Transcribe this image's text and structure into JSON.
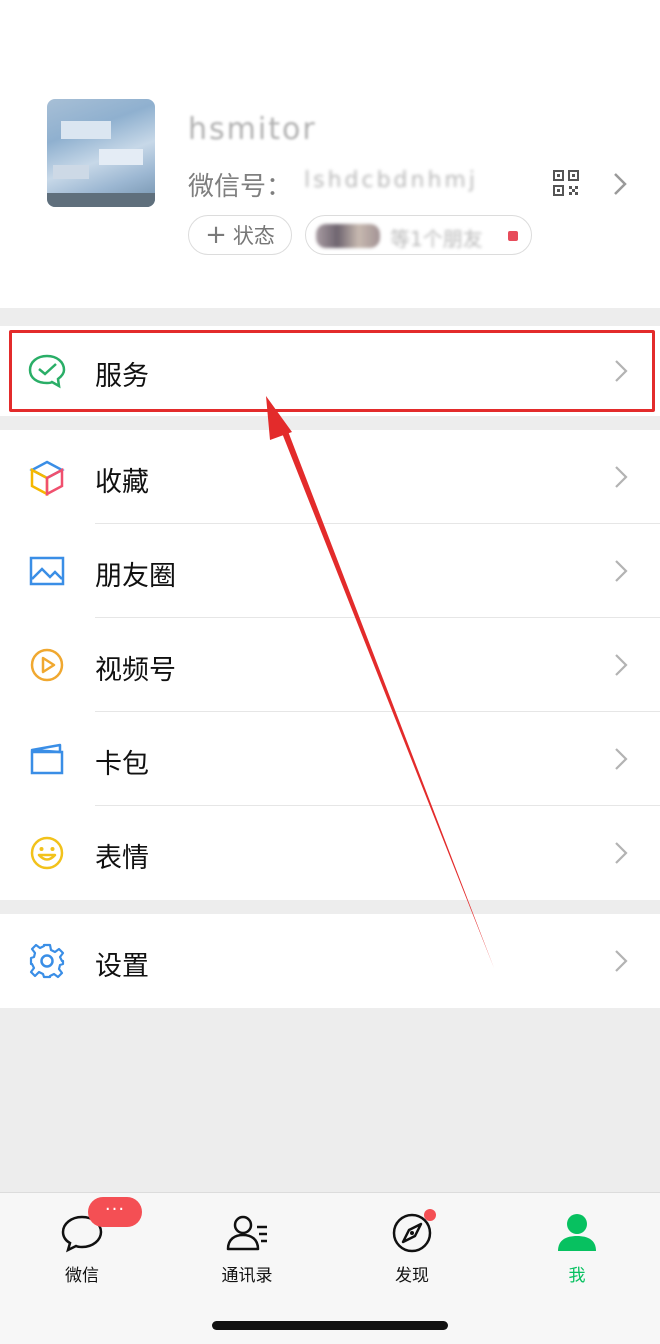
{
  "profile": {
    "nickname": "hsmitor",
    "wxid_label": "微信号：",
    "wxid_value": "lshdcbdnhmj",
    "status_label": "状态",
    "friends_chip_text": "等1个朋友"
  },
  "menu": {
    "service": "服务",
    "favorites": "收藏",
    "moments": "朋友圈",
    "channels": "视频号",
    "cards": "卡包",
    "stickers": "表情",
    "settings": "设置"
  },
  "tabs": {
    "chats": "微信",
    "contacts": "通讯录",
    "discover": "发现",
    "me": "我",
    "chats_badge": "···"
  },
  "colors": {
    "accent_green": "#07c160",
    "highlight_red": "#e32b2b",
    "badge_red": "#f44f54"
  }
}
